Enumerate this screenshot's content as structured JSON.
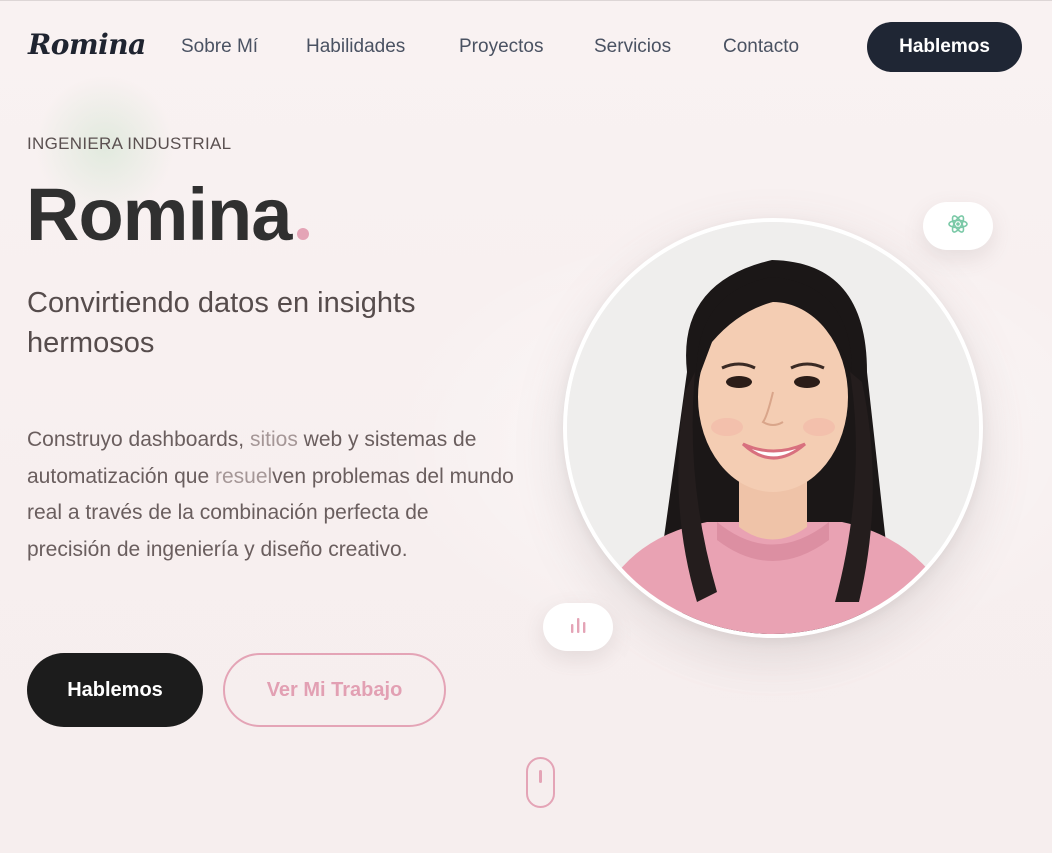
{
  "nav": {
    "logo": "Romina",
    "items": [
      {
        "label": "Sobre Mí"
      },
      {
        "label": "Habilidades"
      },
      {
        "label": "Proyectos"
      },
      {
        "label": "Servicios"
      },
      {
        "label": "Contacto"
      }
    ],
    "cta_label": "Hablemos"
  },
  "hero": {
    "eyebrow": "INGENIERA INDUSTRIAL",
    "name": "Romina",
    "tagline": "Convirtiendo datos en insights hermosos",
    "description": {
      "p1": "Construyo dashboards, ",
      "s1": "sitios",
      "p2": " web y sistemas de automatización que ",
      "s2": "resuel",
      "p3": "ven problemas del mundo real a través de la combinación perfecta de precisión de ingeniería y diseño creativo."
    },
    "primary_button": "Hablemos",
    "secondary_button": "Ver Mi Trabajo"
  },
  "icons": {
    "react_badge": "react-icon",
    "chart_badge": "bar-chart-icon",
    "scroll": "scroll-mouse-icon"
  },
  "colors": {
    "accent_pink": "#e4a4b6",
    "dark": "#1f2634",
    "react_green": "#7bc9a7"
  }
}
